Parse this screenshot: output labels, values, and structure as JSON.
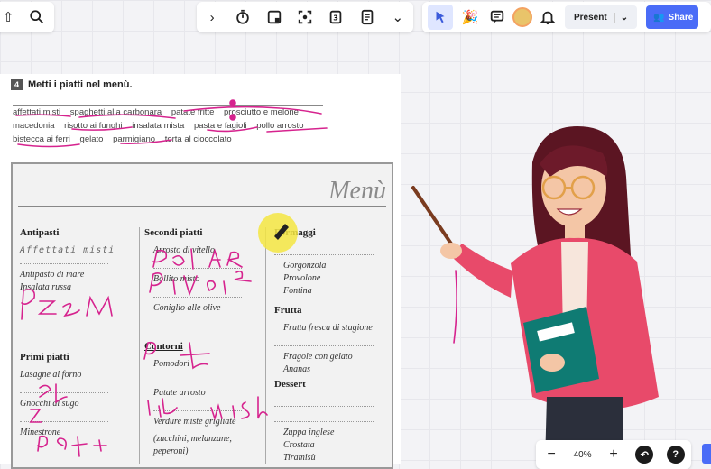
{
  "toolbar": {
    "present_label": "Present",
    "share_label": "Share"
  },
  "doc": {
    "exercise_number": "4",
    "exercise_title": "Metti i piatti nel menù.",
    "words": [
      "affettati misti",
      "spaghetti alla carbonara",
      "patate fritte",
      "prosciutto e melone",
      "macedonia",
      "risotto ai funghi",
      "insalata mista",
      "pasta e fagioli",
      "pollo arrosto",
      "bistecca ai ferri",
      "gelato",
      "parmigiano",
      "torta al cioccolato"
    ]
  },
  "menu": {
    "title": "Menù",
    "antipasti": {
      "heading": "Antipasti",
      "filled": "Affettati misti",
      "items": [
        "Antipasto di mare",
        "Insalata russa"
      ]
    },
    "primi": {
      "heading": "Primi piatti",
      "items": [
        "Lasagne al forno",
        "Gnocchi al sugo",
        "Minestrone"
      ]
    },
    "secondi": {
      "heading": "Secondi piatti",
      "items": [
        "Arrosto di vitello",
        "Bollito misto",
        "Coniglio alle olive"
      ]
    },
    "contorni": {
      "heading": "Contorni",
      "items": [
        "Pomodori",
        "Patate arrosto",
        "Verdure miste grigliate",
        "(zucchini, melanzane,",
        "peperoni)"
      ]
    },
    "formaggi": {
      "heading": "Formaggi",
      "items": [
        "Gorgonzola",
        "Provolone",
        "Fontina"
      ]
    },
    "frutta": {
      "heading": "Frutta",
      "items": [
        "Frutta fresca di stagione",
        "Fragole con gelato",
        "Ananas"
      ]
    },
    "dessert": {
      "heading": "Dessert",
      "items": [
        "Zuppa inglese",
        "Crostata",
        "Tiramisù"
      ]
    }
  },
  "zoom": {
    "level": "40%"
  },
  "colors": {
    "ink": "#d6238e",
    "accent": "#4a6cf7",
    "highlight": "#f5e642"
  }
}
